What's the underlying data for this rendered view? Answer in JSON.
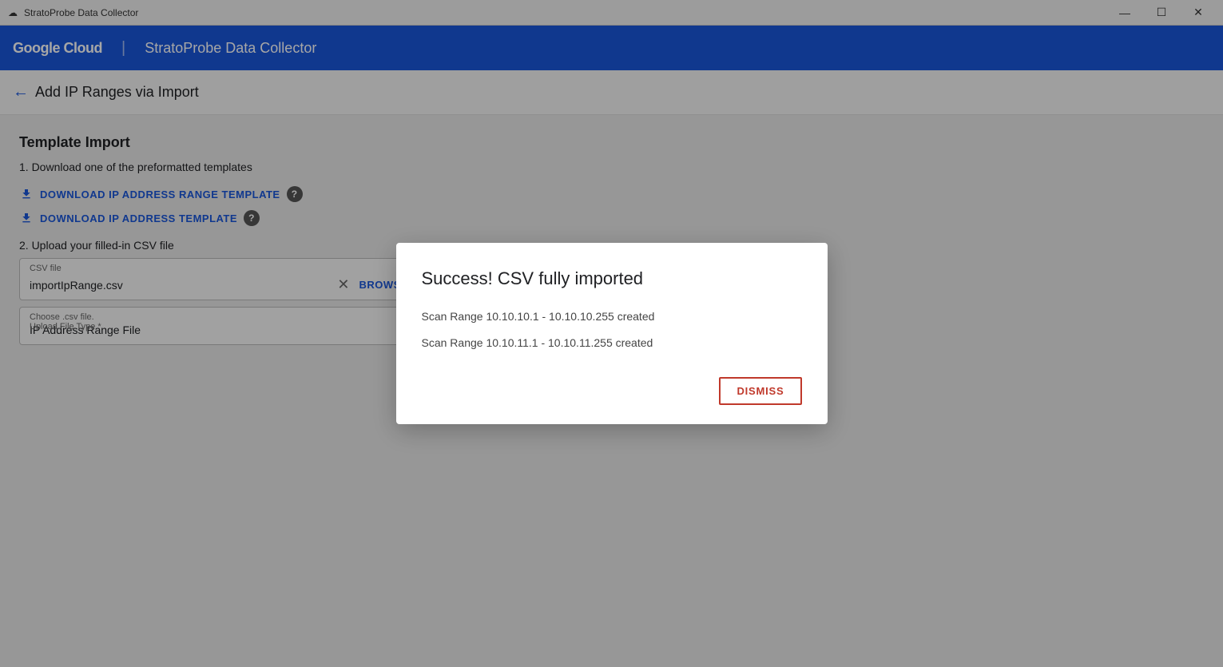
{
  "titleBar": {
    "icon": "☁",
    "title": "StratoProbe Data Collector",
    "minimize": "—",
    "maximize": "☐",
    "close": "✕"
  },
  "navBar": {
    "logo": "Google Cloud",
    "appTitle": "StratoProbe Data Collector"
  },
  "pageHeader": {
    "backLabel": "Add IP Ranges via Import"
  },
  "page": {
    "sectionTitle": "Template Import",
    "step1": "1. Download one of the preformatted templates",
    "download1Label": "DOWNLOAD IP ADDRESS RANGE TEMPLATE",
    "download2Label": "DOWNLOAD IP ADDRESS TEMPLATE",
    "step2": "2. Upload your filled-in CSV file",
    "csvFileLabel": "CSV file",
    "csvFilename": "importIpRange.csv",
    "dropdownLabel": "Choose .csv file.",
    "dropdownSubLabel": "Upload File Type *",
    "dropdownValue": "IP Address Range File"
  },
  "modal": {
    "title": "Success! CSV fully imported",
    "message1": "Scan Range 10.10.10.1 - 10.10.10.255 created",
    "message2": "Scan Range 10.10.11.1 - 10.10.11.255 created",
    "dismissLabel": "DISMISS"
  },
  "colors": {
    "primary": "#1a56db",
    "danger": "#c0392b"
  }
}
